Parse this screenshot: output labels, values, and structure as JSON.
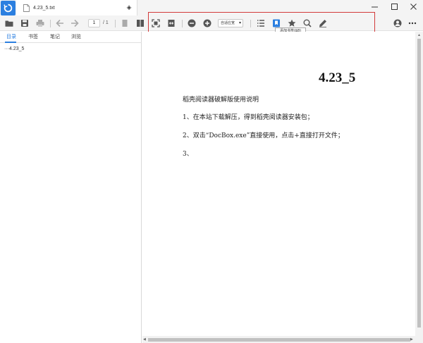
{
  "tab": {
    "title": "4.23_5.txt",
    "close_glyph": "×"
  },
  "new_tab_glyph": "+",
  "toolbar": {
    "page_current": "1",
    "page_total": "/ 1",
    "zoom_mode": "自适应宽",
    "tooltip": "添加书签(&B)"
  },
  "sidebar": {
    "tabs": [
      "目录",
      "书签",
      "笔记",
      "浏览"
    ],
    "outline_items": [
      "···4.23_5"
    ]
  },
  "document": {
    "title": "4.23_5",
    "lines": [
      "稻壳阅读器破解版使用说明",
      "1、在本站下载解压，得到稻壳阅读器安装包；",
      "2、双击“DocBox.exe”直接使用，点击+直接打开文件；",
      "3、"
    ]
  },
  "colors": {
    "accent": "#2b7fe0",
    "highlight": "#d23a3a",
    "icon": "#555555"
  },
  "icons": [
    "app-logo-icon",
    "file-icon",
    "minimize-icon",
    "maximize-icon",
    "close-icon",
    "open-folder-icon",
    "save-icon",
    "print-icon",
    "prev-page-icon",
    "next-page-icon",
    "single-page-icon",
    "double-page-icon",
    "fit-page-icon",
    "fit-width-icon",
    "zoom-out-icon",
    "zoom-in-icon",
    "outline-icon",
    "add-bookmark-icon",
    "favorite-star-icon",
    "search-icon",
    "annotate-pen-icon",
    "user-icon",
    "more-icon"
  ]
}
